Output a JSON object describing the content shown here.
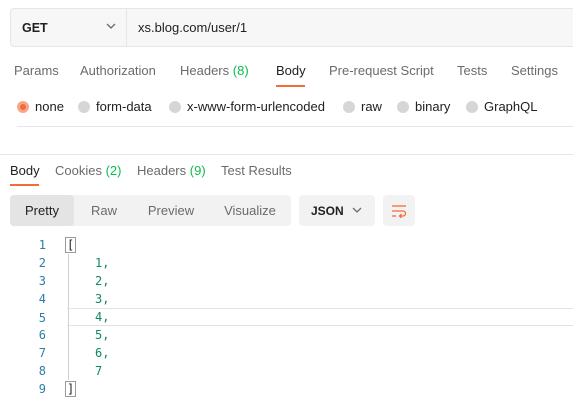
{
  "request": {
    "method": "GET",
    "url": "xs.blog.com/user/1"
  },
  "request_tabs": [
    {
      "label": "Params",
      "count": ""
    },
    {
      "label": "Authorization",
      "count": ""
    },
    {
      "label": "Headers",
      "count": "(8)"
    },
    {
      "label": "Body",
      "count": "",
      "active": true
    },
    {
      "label": "Pre-request Script",
      "count": ""
    },
    {
      "label": "Tests",
      "count": ""
    },
    {
      "label": "Settings",
      "count": ""
    }
  ],
  "body_types": [
    {
      "label": "none",
      "selected": true
    },
    {
      "label": "form-data",
      "selected": false
    },
    {
      "label": "x-www-form-urlencoded",
      "selected": false
    },
    {
      "label": "raw",
      "selected": false
    },
    {
      "label": "binary",
      "selected": false
    },
    {
      "label": "GraphQL",
      "selected": false
    }
  ],
  "response_tabs": [
    {
      "label": "Body",
      "count": "",
      "active": true
    },
    {
      "label": "Cookies",
      "count": "(2)"
    },
    {
      "label": "Headers",
      "count": "(9)"
    },
    {
      "label": "Test Results",
      "count": ""
    }
  ],
  "view_modes": [
    {
      "label": "Pretty",
      "active": true
    },
    {
      "label": "Raw",
      "active": false
    },
    {
      "label": "Preview",
      "active": false
    },
    {
      "label": "Visualize",
      "active": false
    }
  ],
  "format": {
    "selected": "JSON"
  },
  "colors": {
    "accent": "#f26b3a",
    "count": "#0cbb52",
    "line_number": "#2a7fa8",
    "value": "#0e8a5e"
  },
  "icons": {
    "method_dropdown": "chevron-down-icon",
    "format_dropdown": "chevron-down-icon",
    "wrap": "wrap-lines-icon"
  },
  "response_code": {
    "lines": [
      {
        "num": "1",
        "text": "["
      },
      {
        "num": "2",
        "text": "1,"
      },
      {
        "num": "3",
        "text": "2,"
      },
      {
        "num": "4",
        "text": "3,"
      },
      {
        "num": "5",
        "text": "4,"
      },
      {
        "num": "6",
        "text": "5,"
      },
      {
        "num": "7",
        "text": "6,"
      },
      {
        "num": "8",
        "text": "7"
      },
      {
        "num": "9",
        "text": "]"
      }
    ]
  }
}
